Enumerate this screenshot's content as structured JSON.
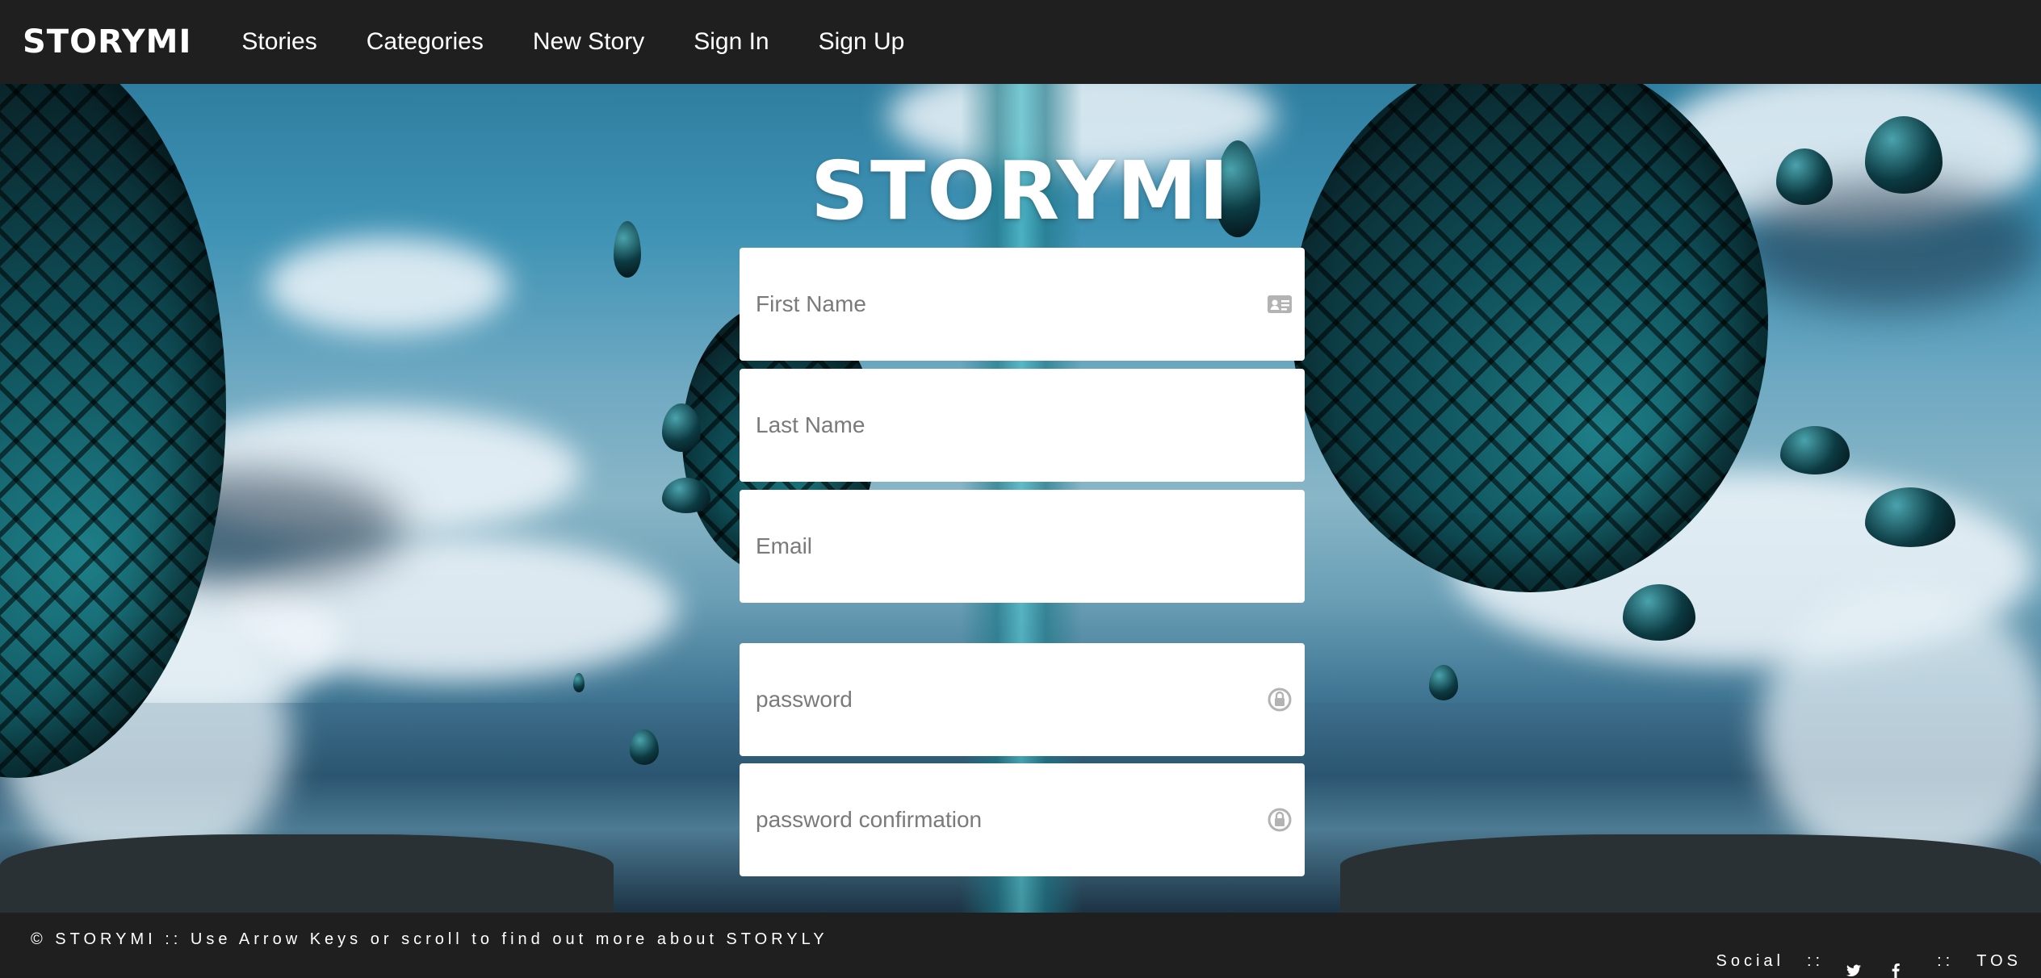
{
  "navbar": {
    "brand": "STORYMI",
    "links": [
      "Stories",
      "Categories",
      "New Story",
      "Sign In",
      "Sign Up"
    ]
  },
  "hero": {
    "title": "STORYMI"
  },
  "form": {
    "first_name_placeholder": "First Name",
    "last_name_placeholder": "Last Name",
    "email_placeholder": "Email",
    "password_placeholder": "password",
    "password_confirmation_placeholder": "password confirmation"
  },
  "icons": {
    "first_name": "id-card-icon",
    "password": "lock-icon",
    "password_confirmation": "lock-icon",
    "twitter": "twitter-icon",
    "facebook": "facebook-icon"
  },
  "footer": {
    "left_text": "© STORYMI :: Use Arrow Keys or scroll to find out more about STORYLY",
    "social_label": "Social",
    "separator": "::",
    "tos_label": "TOS"
  },
  "colors": {
    "navbar_bg": "#1f1f1f",
    "footer_bg": "#1f1f1f",
    "field_bg": "#ffffff",
    "placeholder": "#7a7a7a",
    "text_light": "#ffffff"
  }
}
